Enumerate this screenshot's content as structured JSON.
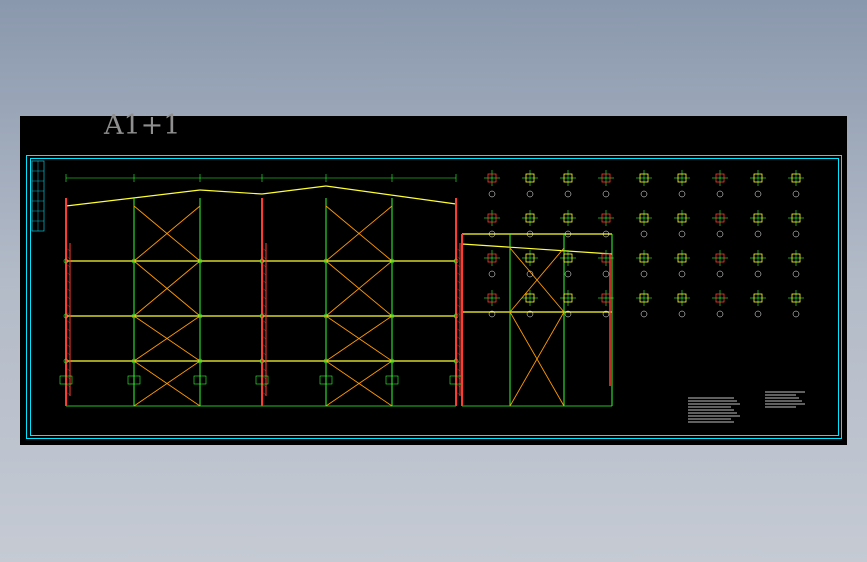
{
  "sheet": {
    "title": "A1+1"
  },
  "colors": {
    "canvas_background": "#000000",
    "page_background": "#9aa5b6",
    "frame": "#00ffff",
    "column": "#ff3b30",
    "beam": "#ffff33",
    "brace": "#ff9900",
    "annotation": "#33ff33",
    "text": "#ffffff",
    "title_text": "#8f8f8f"
  },
  "drawing": {
    "type": "steel-frame elevation sheet",
    "views": [
      "main-elevation",
      "secondary-elevation",
      "detail-sheet"
    ],
    "main_elevation": {
      "bays": 6,
      "tiers": 4
    },
    "secondary_elevation": {
      "bays": 3,
      "tiers": 3
    },
    "detail_count": 36,
    "notes_blocks": 2
  }
}
